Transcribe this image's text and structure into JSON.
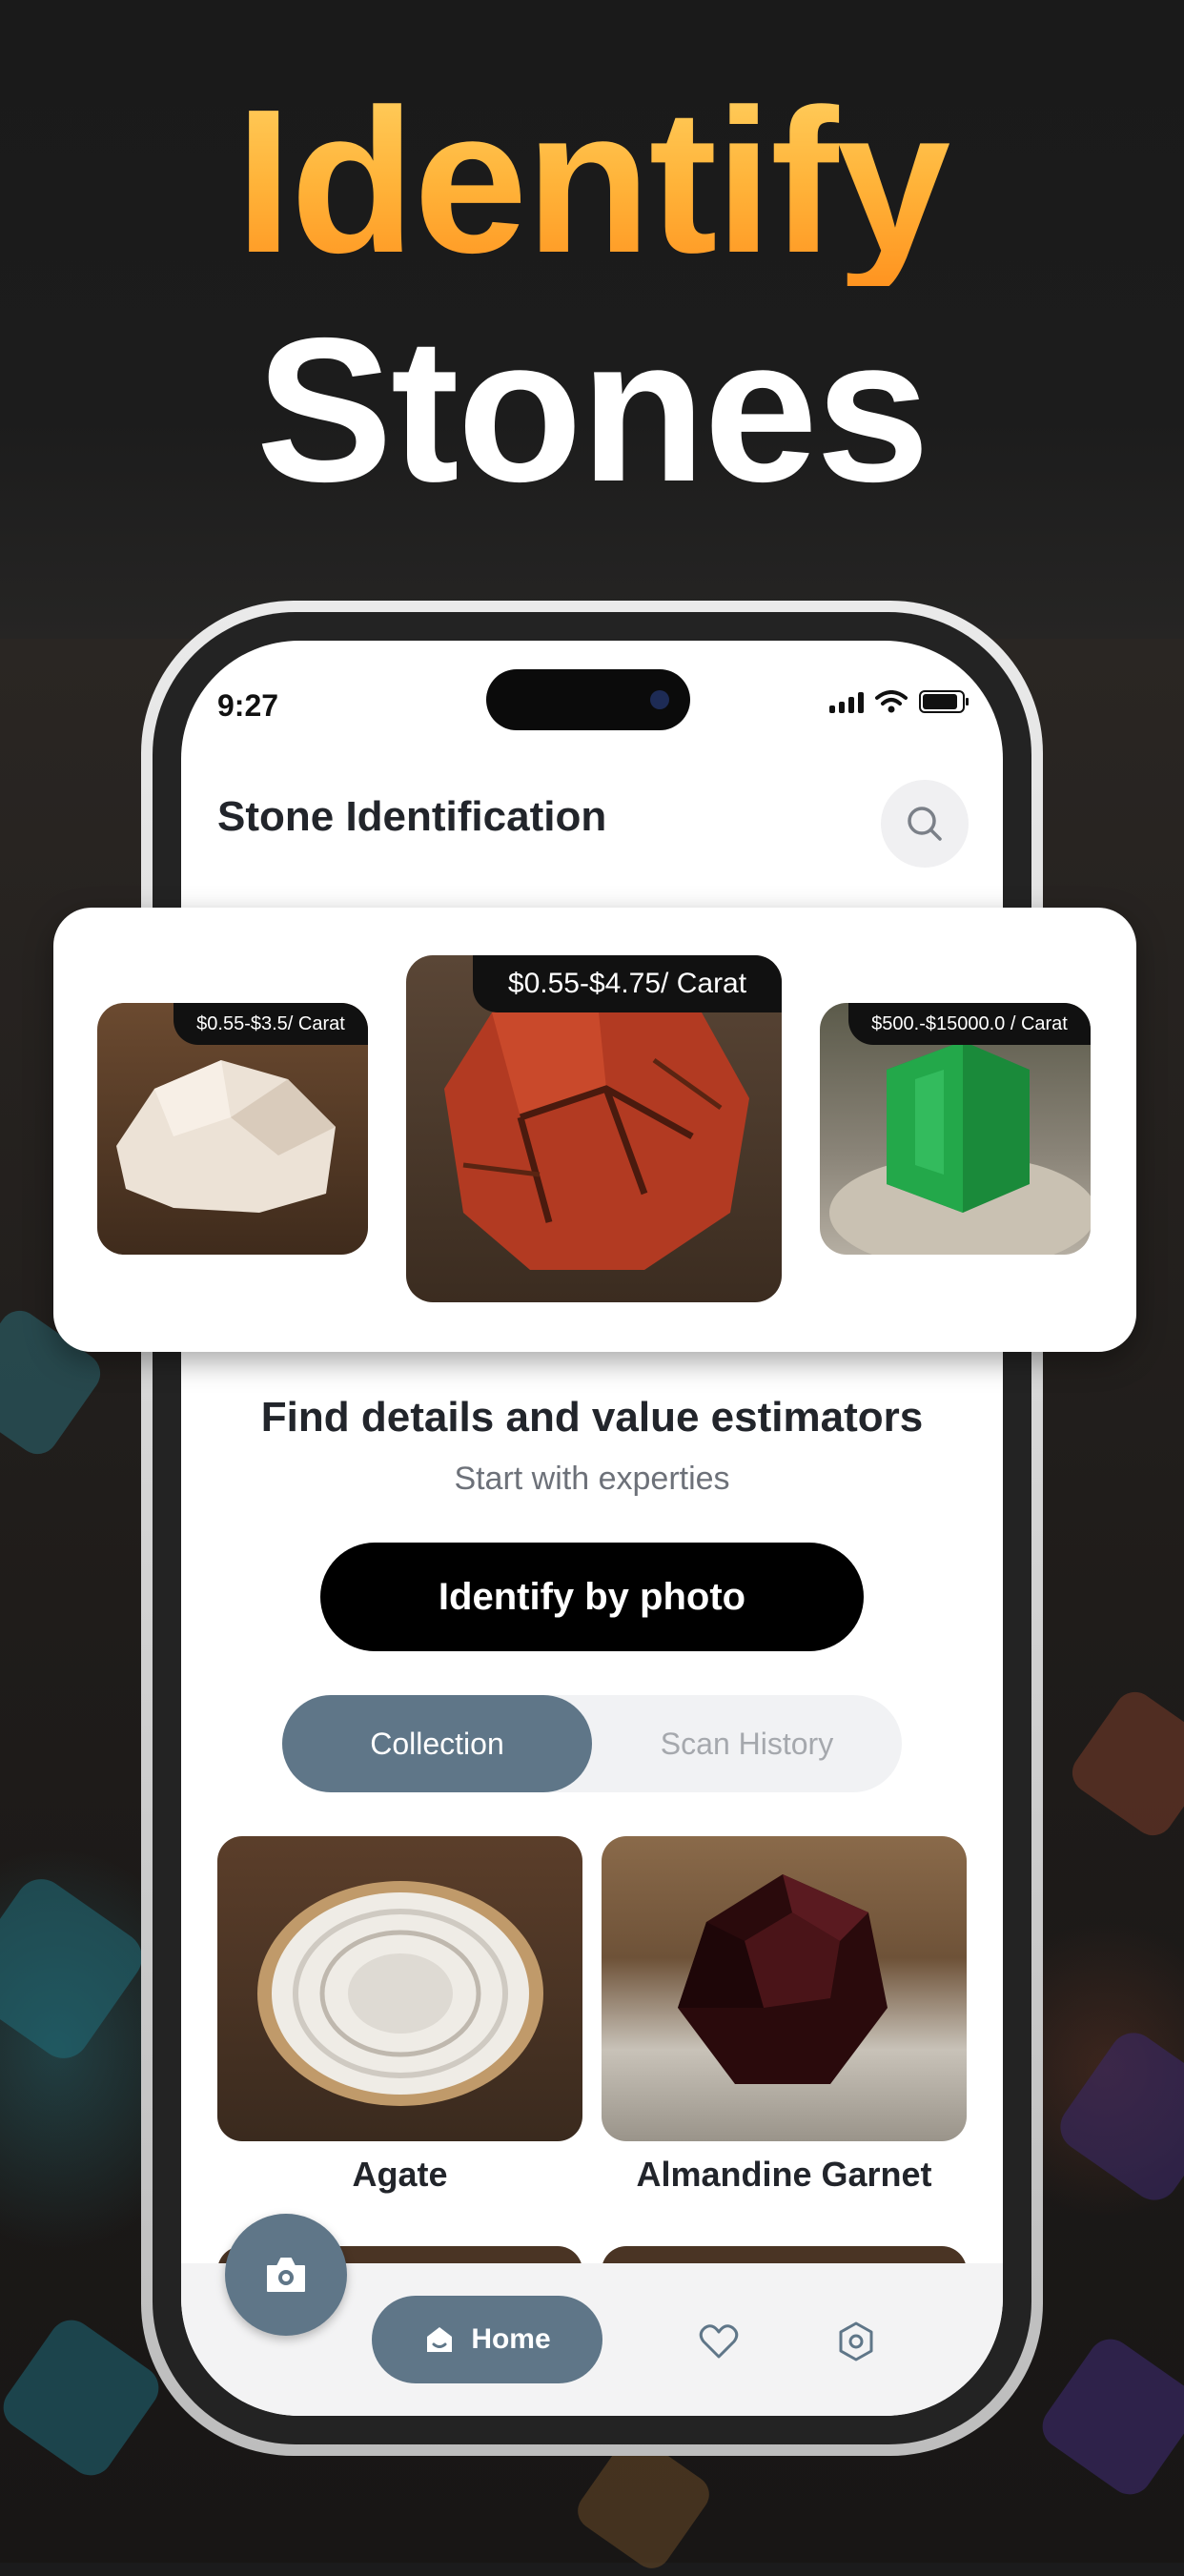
{
  "headline": {
    "line1": "Identify",
    "line2": "Stones"
  },
  "status_bar": {
    "time": "9:27"
  },
  "app": {
    "title": "Stone Identification"
  },
  "carousel": {
    "items": [
      {
        "price": "$0.55-$3.5/ Carat",
        "image": "white-quartz-stone"
      },
      {
        "price": "$0.55-$4.75/ Carat",
        "image": "red-jasper-stone"
      },
      {
        "price": "$500.-$15000.0 / Carat",
        "image": "emerald-crystal"
      }
    ]
  },
  "hero": {
    "title": "Find details and value estimators",
    "subtitle": "Start with experties",
    "button_label": "Identify by photo"
  },
  "tabs": {
    "collection": "Collection",
    "scan_history": "Scan History",
    "active": "Collection"
  },
  "collection": {
    "items": [
      {
        "name": "Agate",
        "image": "agate-slice"
      },
      {
        "name": "Almandine Garnet",
        "image": "almandine-garnet"
      }
    ]
  },
  "bottom_nav": {
    "home_label": "Home",
    "icons": [
      "home-icon",
      "heart-icon",
      "settings-icon",
      "camera-icon"
    ]
  },
  "colors": {
    "accent": "#5f7688",
    "headline_gradient": [
      "#ffd060",
      "#ff9420"
    ],
    "button": "#000000"
  }
}
